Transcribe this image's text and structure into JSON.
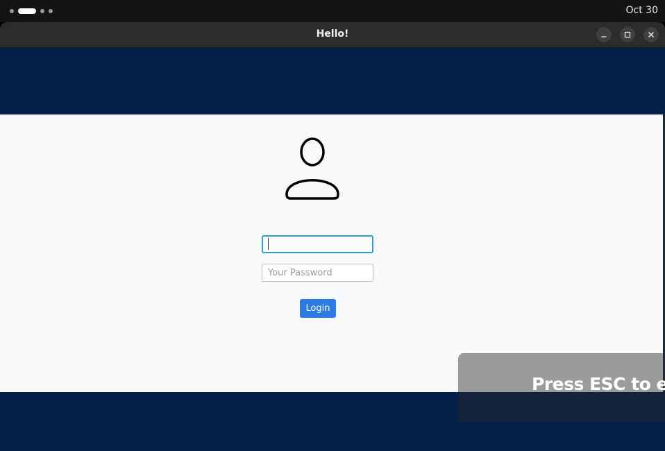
{
  "system": {
    "clock": "Oct 30",
    "workspaces": {
      "count": 4,
      "active_index": 1
    }
  },
  "window": {
    "title": "Hello!",
    "buttons": [
      "minimize",
      "maximize",
      "close"
    ]
  },
  "login": {
    "username_value": "",
    "username_placeholder": "",
    "password_placeholder": "Your Password",
    "login_label": "Login"
  },
  "overlay": {
    "esc_text": "Press ESC to exit"
  },
  "icons": {
    "avatar": "user-icon",
    "minimize": "minimize-icon",
    "maximize": "maximize-icon",
    "close": "close-icon"
  },
  "colors": {
    "header_band": "#04204b",
    "content_bg": "#f7f9fa",
    "login_button": "#2c7be5",
    "focus_ring": "#2b9fd6"
  }
}
